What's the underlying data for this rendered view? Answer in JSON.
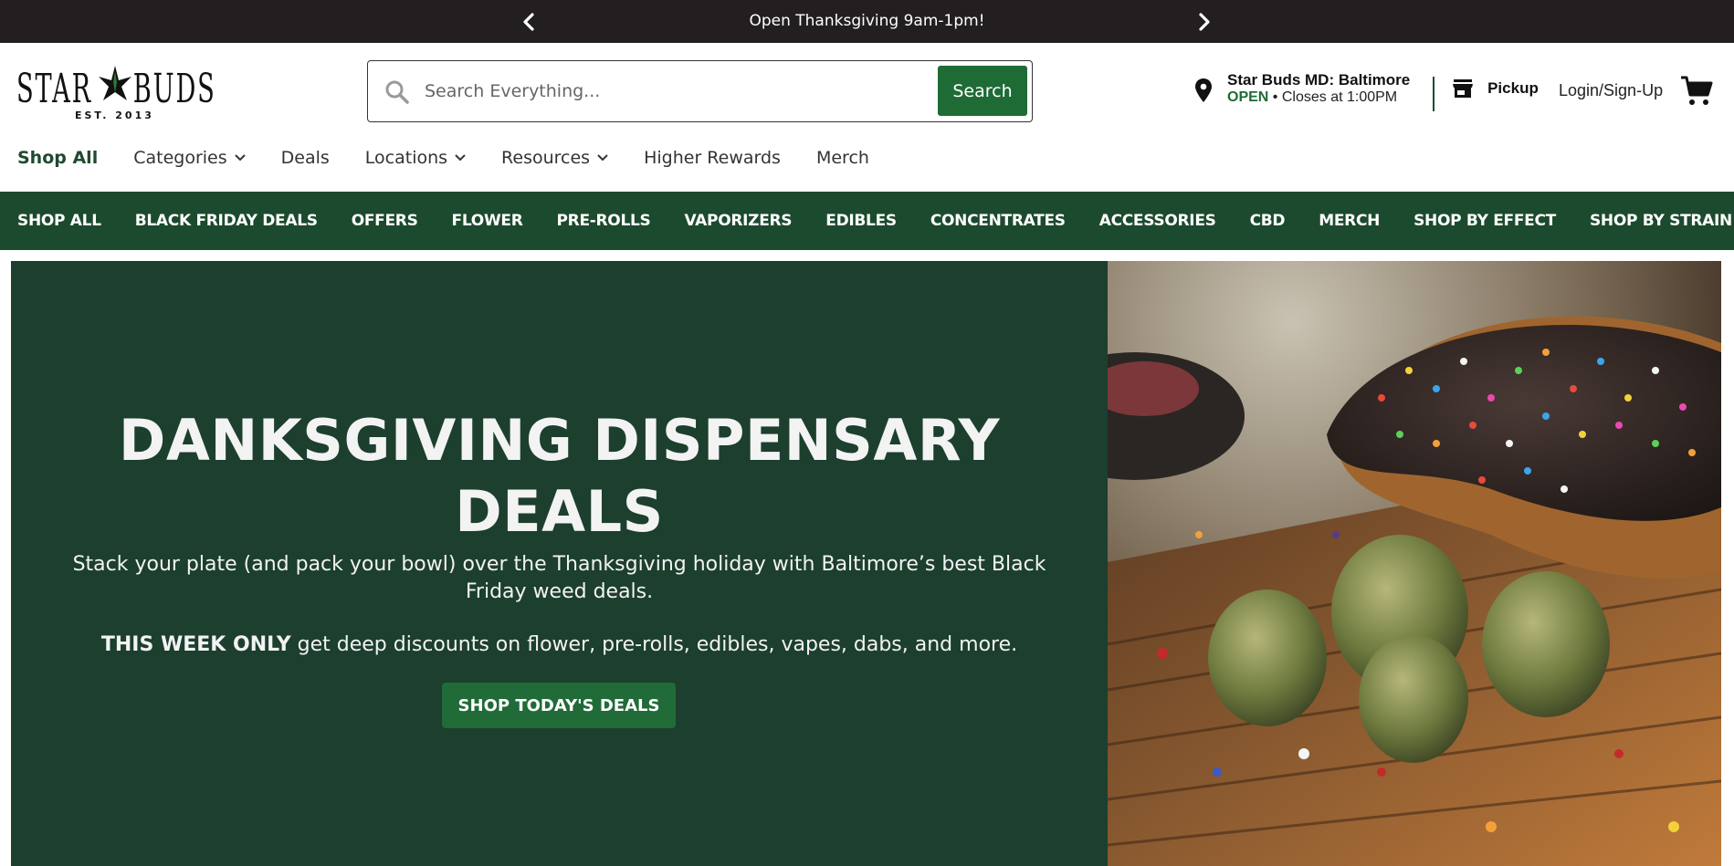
{
  "announcement": {
    "text": "Open Thanksgiving 9am-1pm!",
    "prev_icon": "chevron-left-icon",
    "next_icon": "chevron-right-icon"
  },
  "logo": {
    "text": "STAR BUDS",
    "est": "EST. 2013"
  },
  "search": {
    "placeholder": "Search Everything...",
    "button_label": "Search"
  },
  "store": {
    "name": "Star Buds MD: Baltimore",
    "status": "OPEN",
    "hours": " • Closes at 1:00PM"
  },
  "pickup": {
    "label": "Pickup"
  },
  "account": {
    "login_label": "Login/Sign-Up"
  },
  "main_nav": {
    "shop_all": "Shop All",
    "categories": "Categories",
    "deals": "Deals",
    "locations": "Locations",
    "resources": "Resources",
    "higher_rewards": "Higher Rewards",
    "merch": "Merch"
  },
  "category_bar": [
    "SHOP ALL",
    "BLACK FRIDAY DEALS",
    "OFFERS",
    "FLOWER",
    "PRE-ROLLS",
    "VAPORIZERS",
    "EDIBLES",
    "CONCENTRATES",
    "ACCESSORIES",
    "CBD",
    "MERCH",
    "SHOP BY EFFECT",
    "SHOP BY STRAIN"
  ],
  "hero": {
    "title_line1": "DANKSGIVING DISPENSARY",
    "title_line2": "DEALS",
    "paragraph1": "Stack your plate (and pack your bowl) over the Thanksgiving holiday with Baltimore’s best Black Friday weed deals.",
    "paragraph2_bold": "THIS WEEK ONLY",
    "paragraph2_rest": " get deep discounts on flower, pre-rolls, edibles, vapes, dabs, and more.",
    "cta_label": "SHOP TODAY'S DEALS"
  },
  "colors": {
    "brand_green": "#1f6b35",
    "dark_green": "#1c4a2e",
    "hero_bg": "#1c3f2e",
    "announce_bg": "#231f20"
  }
}
